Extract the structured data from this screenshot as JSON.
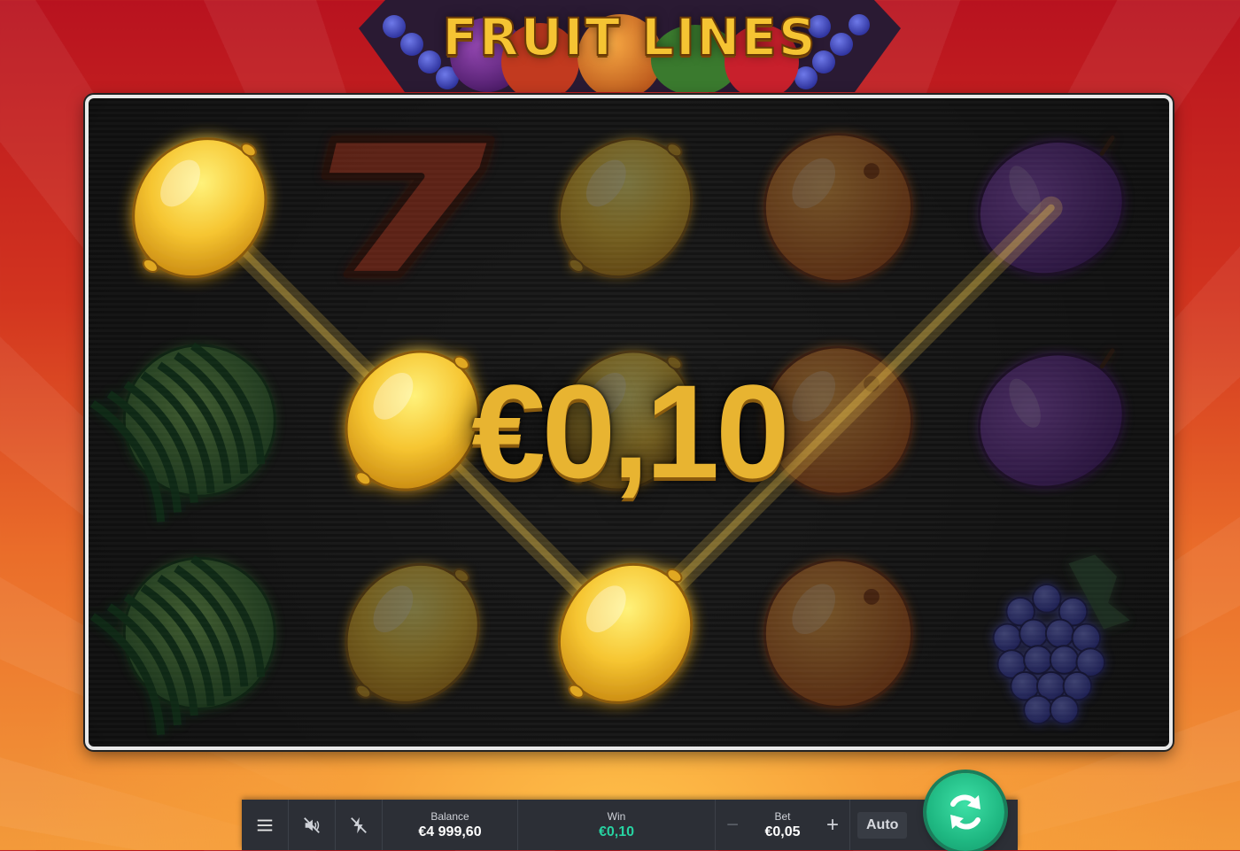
{
  "game": {
    "title": "FRUIT LINES"
  },
  "win_display": {
    "amount": "€0,10"
  },
  "reels": {
    "columns": 5,
    "rows": 3,
    "grid": [
      [
        "lemon",
        "seven",
        "lemon",
        "orange",
        "plum"
      ],
      [
        "watermelon",
        "lemon",
        "lemon",
        "orange",
        "plum"
      ],
      [
        "watermelon",
        "lemon",
        "lemon",
        "orange",
        "grapes"
      ]
    ],
    "winning": [
      [
        0,
        0
      ],
      [
        1,
        1
      ],
      [
        2,
        2
      ]
    ],
    "colors": {
      "lemon": "#f6c531",
      "seven": "#c0391b",
      "orange": "#f08a1f",
      "plum": "#7b39b2",
      "watermelon": "#2f8f3c",
      "grapes": "#3a3fd2",
      "payline": "#f2c94c"
    }
  },
  "bottom_bar": {
    "menu_icon": "hamburger-menu-icon",
    "sound_icon": "sound-off-icon",
    "turbo_icon": "turbo-off-icon",
    "balance_label": "Balance",
    "balance_value": "€4 999,60",
    "win_label": "Win",
    "win_value": "€0,10",
    "bet_label": "Bet",
    "bet_value": "€0,05",
    "bet_minus": "−",
    "bet_plus": "+",
    "auto_label": "Auto",
    "spin_icon": "spin-refresh-icon",
    "accent": "#27d3a2"
  }
}
